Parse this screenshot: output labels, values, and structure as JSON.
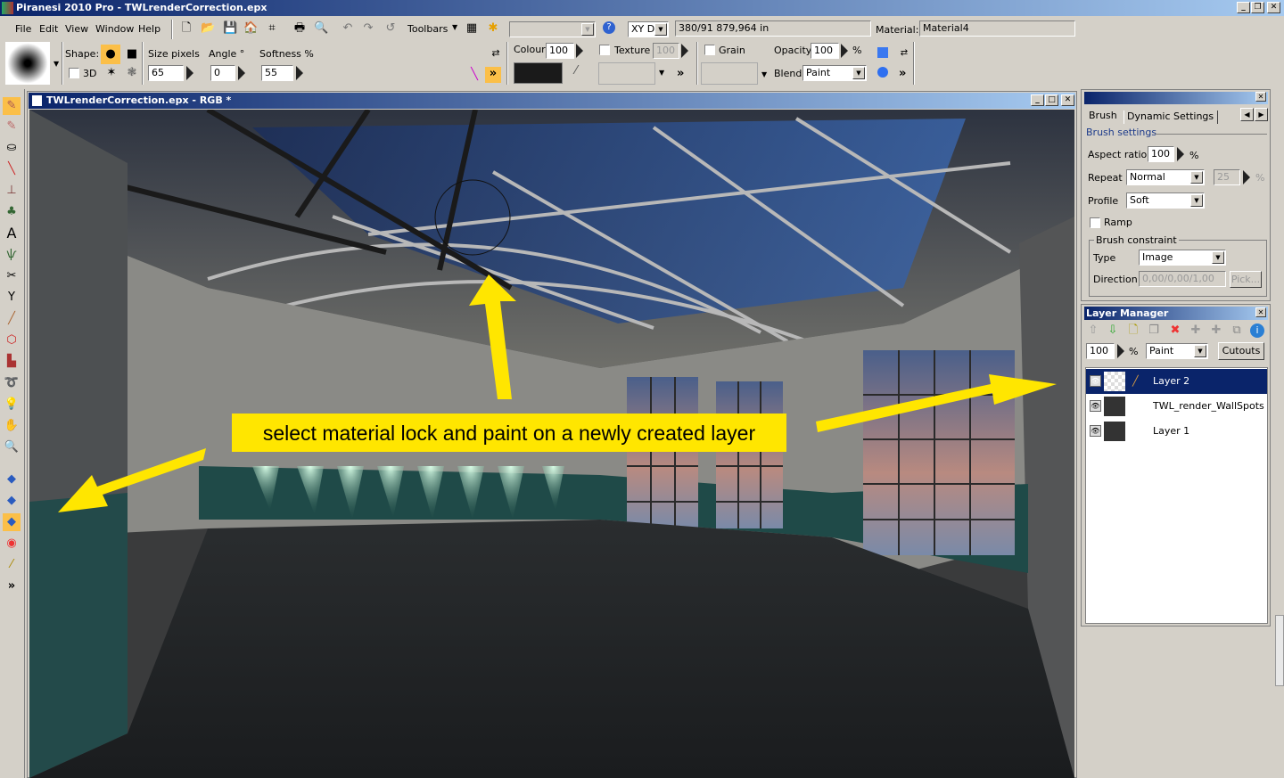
{
  "app": {
    "title": "Piranesi 2010 Pro - TWLrenderCorrection.epx"
  },
  "menu": [
    "File",
    "Edit",
    "View",
    "Window",
    "Help"
  ],
  "toolbar": {
    "toolbars_label": "Toolbars",
    "xy_mode": "XY D",
    "coordinates": "380/91 879,964 in",
    "material_label": "Material:",
    "material_value": "Material4"
  },
  "brush_bar": {
    "shape_label": "Shape:",
    "3d_label": "3D",
    "size_label": "Size  pixels",
    "size_value": "65",
    "angle_label": "Angle  °",
    "angle_value": "0",
    "softness_label": "Softness %",
    "softness_value": "55",
    "colour_label": "Colour",
    "colour_value": "100",
    "colour_swatch": "#1a1a1a",
    "texture_label": "Texture",
    "texture_value": "100",
    "grain_label": "Grain",
    "opacity_label": "Opacity",
    "opacity_value": "100",
    "percent": "%",
    "blend_label": "Blend",
    "blend_value": "Paint"
  },
  "document": {
    "title": "TWLrenderCorrection.epx - RGB *",
    "annotation": "select material lock and paint on a newly created layer",
    "annotation_color": "#ffe600"
  },
  "brush_panel": {
    "tabs": [
      "Brush",
      "Dynamic Settings"
    ],
    "section": "Brush settings",
    "aspect_label": "Aspect ratio",
    "aspect_value": "100",
    "percent": "%",
    "repeat_label": "Repeat",
    "repeat_value": "Normal",
    "repeat_amount": "25",
    "profile_label": "Profile",
    "profile_value": "Soft",
    "ramp_label": "Ramp",
    "constraint_label": "Brush constraint",
    "type_label": "Type",
    "type_value": "Image",
    "direction_label": "Direction",
    "direction_value": "0,00/0,00/1,00",
    "pick_label": "Pick..."
  },
  "layer_manager": {
    "title": "Layer Manager",
    "opacity": "100",
    "percent": "%",
    "mode": "Paint",
    "cutouts": "Cutouts",
    "layers": [
      {
        "name": "Layer 2",
        "selected": true
      },
      {
        "name": "TWL_render_WallSpots",
        "selected": false
      },
      {
        "name": "Layer 1",
        "selected": false
      }
    ]
  }
}
